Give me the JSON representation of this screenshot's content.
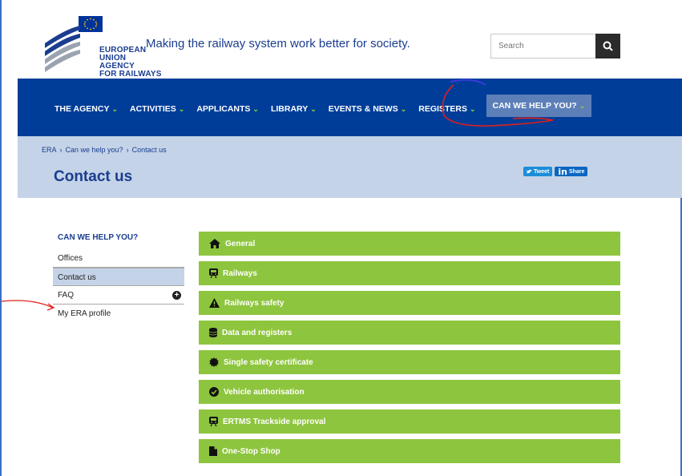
{
  "header": {
    "logo_lines": [
      "EUROPEAN",
      "UNION",
      "AGENCY",
      "FOR RAILWAYS"
    ],
    "tagline": "Making the railway system work better for society.",
    "search_placeholder": "Search"
  },
  "nav": {
    "items": [
      {
        "label": "THE AGENCY"
      },
      {
        "label": "ACTIVITIES"
      },
      {
        "label": "APPLICANTS"
      },
      {
        "label": "LIBRARY"
      },
      {
        "label": "EVENTS & NEWS"
      },
      {
        "label": "REGISTERS"
      },
      {
        "label": "CAN WE HELP YOU?"
      }
    ]
  },
  "breadcrumb": [
    "ERA",
    "Can we help you?",
    "Contact us"
  ],
  "page_title": "Contact us",
  "social": {
    "tweet": "Tweet",
    "share": "Share",
    "in": "in"
  },
  "sidebar": {
    "title": "CAN WE HELP YOU?",
    "items": [
      {
        "label": "Offices"
      },
      {
        "label": "Contact us"
      },
      {
        "label": "FAQ"
      },
      {
        "label": "My ERA profile"
      }
    ]
  },
  "accordion": [
    {
      "label": "General",
      "icon": "home-icon"
    },
    {
      "label": "Railways",
      "icon": "train-icon"
    },
    {
      "label": "Railways safety",
      "icon": "warning-icon"
    },
    {
      "label": "Data and registers",
      "icon": "database-icon"
    },
    {
      "label": "Single safety certificate",
      "icon": "certificate-icon"
    },
    {
      "label": "Vehicle authorisation",
      "icon": "check-circle-icon"
    },
    {
      "label": "ERTMS Trackside approval",
      "icon": "train-icon"
    },
    {
      "label": "One-Stop Shop",
      "icon": "file-icon"
    }
  ],
  "colors": {
    "nav": "#003d99",
    "band": "#c4d3e7",
    "accordion": "#8ec53e",
    "annotation": "#e0201a"
  }
}
